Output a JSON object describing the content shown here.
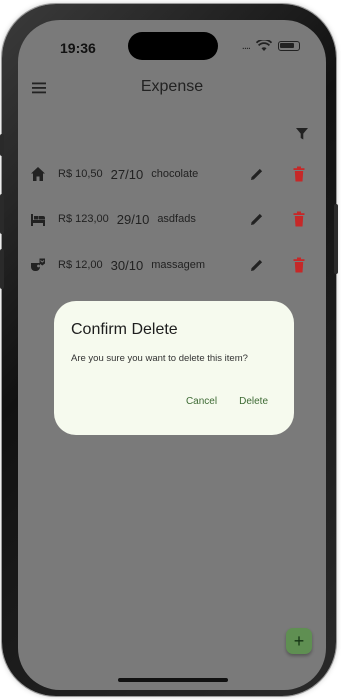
{
  "status_bar": {
    "time": "19:36",
    "signal": "....",
    "icons": [
      "wifi-icon",
      "battery-icon"
    ]
  },
  "app_bar": {
    "title": "Expense",
    "menu_icon": "menu-icon",
    "filter_icon": "filter-icon"
  },
  "expenses": [
    {
      "icon": "home-icon",
      "amount": "R$ 10,50",
      "date": "27/10",
      "description": "chocolate"
    },
    {
      "icon": "bed-icon",
      "amount": "R$ 123,00",
      "date": "29/10",
      "description": "asdfads"
    },
    {
      "icon": "spa-icon",
      "amount": "R$ 12,00",
      "date": "30/10",
      "description": "massagem"
    }
  ],
  "dialog": {
    "title": "Confirm Delete",
    "message": "Are you sure you want to delete this item?",
    "cancel_label": "Cancel",
    "delete_label": "Delete"
  },
  "fab": {
    "label": "+"
  },
  "colors": {
    "scrim": "#7a7a7a",
    "dialog_bg": "#f6faee",
    "accent": "#3d6a34",
    "delete": "#c62828",
    "fab": "#5f8f52"
  }
}
